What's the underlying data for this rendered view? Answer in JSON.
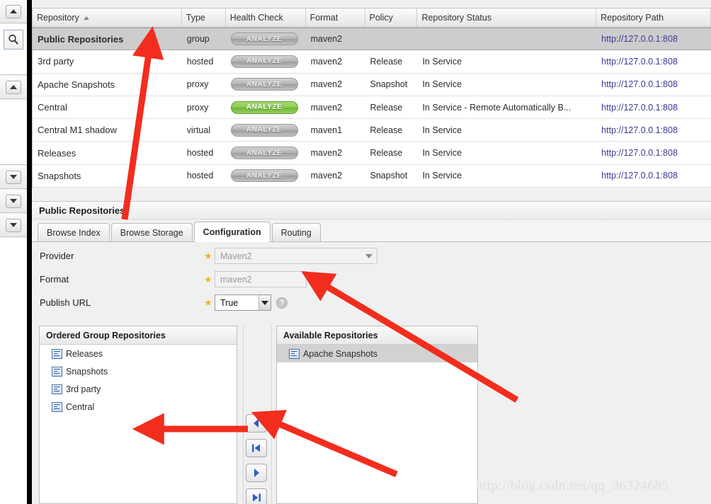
{
  "left_rail": {
    "collapse_up_1": "collapse-up",
    "search_icon": "search-icon",
    "collapse_up_2": "collapse-up",
    "collapse_down_1": "collapse-down",
    "collapse_down_2": "collapse-down",
    "collapse_down_3": "collapse-down"
  },
  "grid": {
    "columns": [
      {
        "label": "Repository",
        "sorted": "asc"
      },
      {
        "label": "Type"
      },
      {
        "label": "Health Check"
      },
      {
        "label": "Format"
      },
      {
        "label": "Policy"
      },
      {
        "label": "Repository Status"
      },
      {
        "label": "Repository Path"
      }
    ],
    "analyze_label": "ANALYZE",
    "rows": [
      {
        "name": "Public Repositories",
        "type": "group",
        "health": "ANALYZE",
        "health_state": "gray",
        "format": "maven2",
        "policy": "",
        "status": "",
        "path": "http://127.0.0.1:808",
        "selected": true
      },
      {
        "name": "3rd party",
        "type": "hosted",
        "health": "ANALYZE",
        "health_state": "gray",
        "format": "maven2",
        "policy": "Release",
        "status": "In Service",
        "path": "http://127.0.0.1:808",
        "selected": false
      },
      {
        "name": "Apache Snapshots",
        "type": "proxy",
        "health": "ANALYZE",
        "health_state": "gray",
        "format": "maven2",
        "policy": "Snapshot",
        "status": "In Service",
        "path": "http://127.0.0.1:808",
        "selected": false
      },
      {
        "name": "Central",
        "type": "proxy",
        "health": "ANALYZE",
        "health_state": "green",
        "format": "maven2",
        "policy": "Release",
        "status": "In Service - Remote Automatically B...",
        "path": "http://127.0.0.1:808",
        "selected": false
      },
      {
        "name": "Central M1 shadow",
        "type": "virtual",
        "health": "ANALYZE",
        "health_state": "gray",
        "format": "maven1",
        "policy": "Release",
        "status": "In Service",
        "path": "http://127.0.0.1:808",
        "selected": false
      },
      {
        "name": "Releases",
        "type": "hosted",
        "health": "ANALYZE",
        "health_state": "gray",
        "format": "maven2",
        "policy": "Release",
        "status": "In Service",
        "path": "http://127.0.0.1:808",
        "selected": false
      },
      {
        "name": "Snapshots",
        "type": "hosted",
        "health": "ANALYZE",
        "health_state": "gray",
        "format": "maven2",
        "policy": "Snapshot",
        "status": "In Service",
        "path": "http://127.0.0.1:808",
        "selected": false
      }
    ]
  },
  "detail": {
    "title": "Public Repositories",
    "tabs": [
      {
        "label": "Browse Index",
        "active": false
      },
      {
        "label": "Browse Storage",
        "active": false
      },
      {
        "label": "Configuration",
        "active": true
      },
      {
        "label": "Routing",
        "active": false
      }
    ],
    "form": {
      "provider": {
        "label": "Provider",
        "value": "Maven2",
        "required": true,
        "readonly": true
      },
      "format": {
        "label": "Format",
        "value": "maven2",
        "required": true,
        "readonly": true
      },
      "publish_url": {
        "label": "Publish URL",
        "value": "True",
        "required": true,
        "readonly": false,
        "help": "?"
      }
    }
  },
  "transfer": {
    "ordered": {
      "title": "Ordered Group Repositories",
      "items": [
        {
          "label": "Releases",
          "selected": false
        },
        {
          "label": "Snapshots",
          "selected": false
        },
        {
          "label": "3rd party",
          "selected": false
        },
        {
          "label": "Central",
          "selected": false
        }
      ]
    },
    "available": {
      "title": "Available Repositories",
      "items": [
        {
          "label": "Apache Snapshots",
          "selected": true
        }
      ]
    },
    "buttons": [
      {
        "name": "move-left-button",
        "glyph": "◀"
      },
      {
        "name": "move-all-left-button",
        "glyph": "|◀"
      },
      {
        "name": "move-right-button",
        "glyph": "▶"
      },
      {
        "name": "move-all-right-button",
        "glyph": "▶|"
      }
    ]
  },
  "watermark": {
    "text": "http://blog.csdn.net/qq_36324685"
  },
  "colors": {
    "accent_green": "#7dc24b",
    "link_blue": "#3a3a96",
    "annotation_red": "#f22d1e",
    "star_gold": "#f0b429",
    "selection_gray": "#cdcdcd"
  }
}
